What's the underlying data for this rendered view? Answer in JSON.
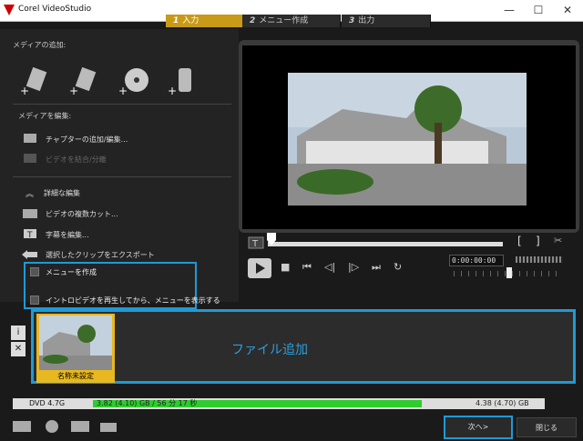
{
  "window": {
    "title": "Corel VideoStudio",
    "min": "—",
    "max": "☐",
    "close": "✕"
  },
  "steps": [
    {
      "num": "1",
      "label": "入力"
    },
    {
      "num": "2",
      "label": "メニュー作成"
    },
    {
      "num": "3",
      "label": "出力"
    }
  ],
  "left": {
    "add_media_label": "メディアの追加:",
    "edit_media_label": "メディアを編集:",
    "chapter": "チャプターの追加/編集...",
    "merge": "ビデオを結合/分離",
    "advanced": "詳細な編集",
    "multicut": "ビデオの複数カット...",
    "subtitle": "字幕を編集...",
    "export": "選択したクリップをエクスポート",
    "create_menu": "メニューを作成",
    "intro": "イントロビデオを再生してから、メニューを表示する"
  },
  "player": {
    "timecode": "0:00:00:00",
    "bracket_in": "[",
    "bracket_out": "]"
  },
  "media": {
    "thumb_label": "名称未設定",
    "add_file": "ファイル追加"
  },
  "bottom": {
    "disc": "DVD 4.7G",
    "used": "3.82 (4.10) GB / 56 分 17 秒",
    "total": "4.38 (4.70) GB",
    "capacity_fraction": 0.73,
    "next": "次へ>",
    "close": "閉じる"
  }
}
